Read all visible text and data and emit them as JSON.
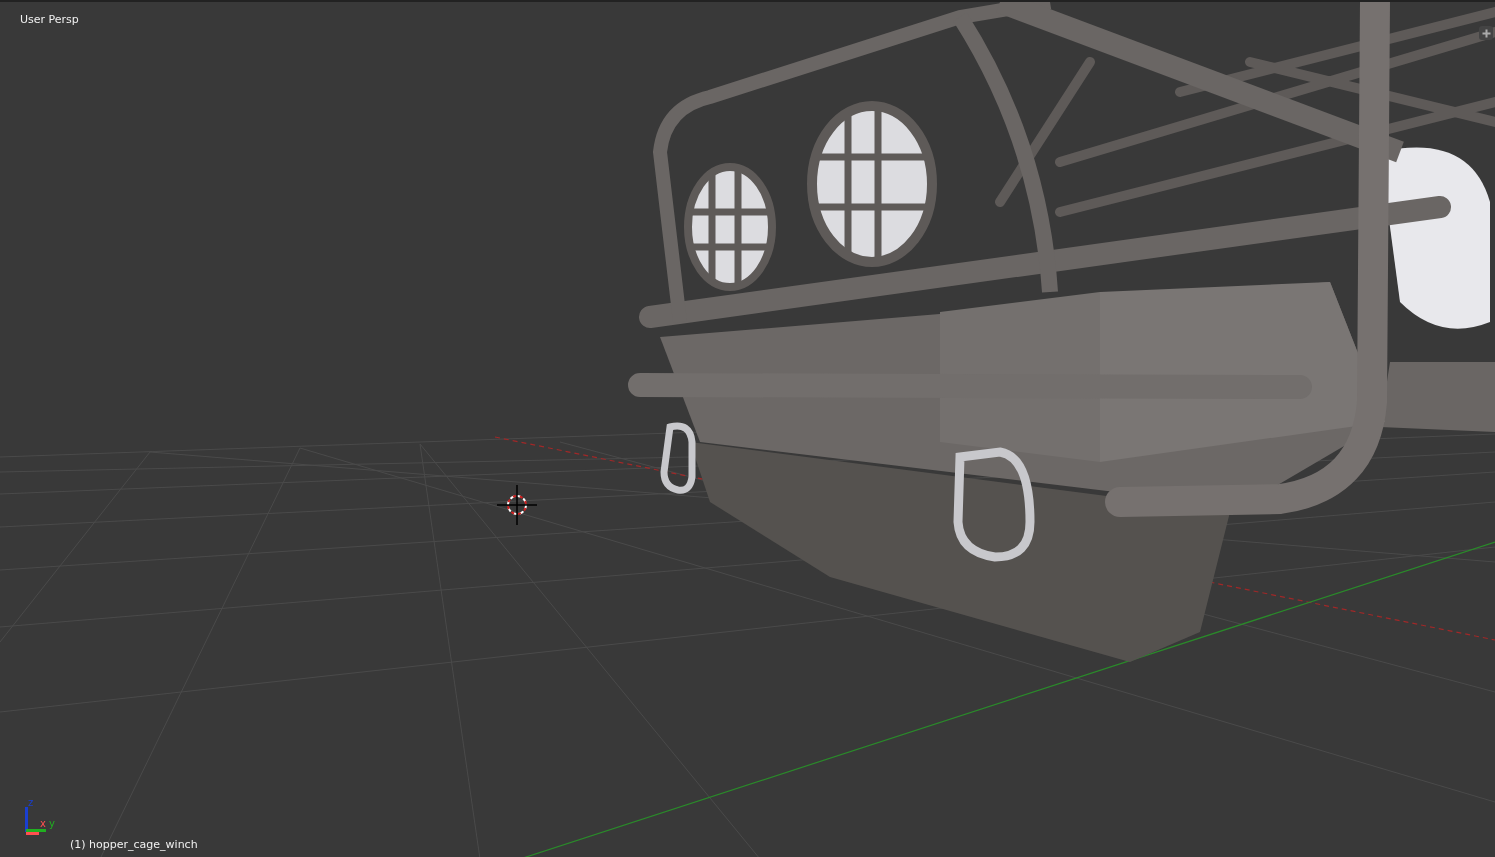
{
  "viewport": {
    "view_label": "User Persp",
    "object_label": "(1) hopper_cage_winch",
    "axes": [
      {
        "label": "z",
        "color": "#1a3fd0"
      },
      {
        "label": "x",
        "color": "#ff5050"
      },
      {
        "label": "y",
        "color": "#20b020"
      }
    ]
  }
}
